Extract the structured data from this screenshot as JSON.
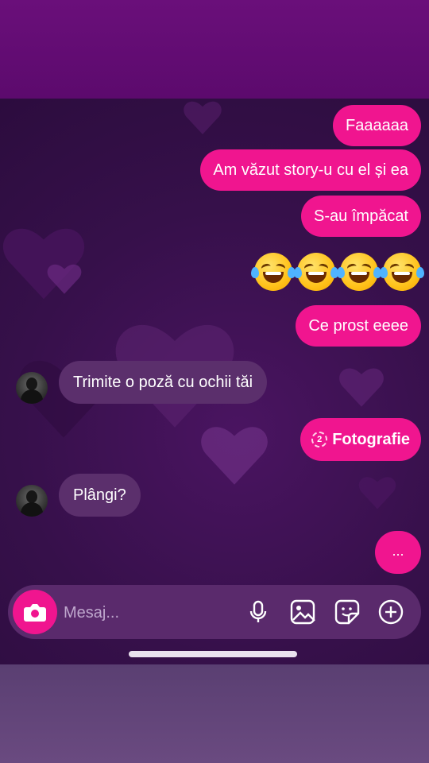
{
  "messages": [
    {
      "type": "outgoing",
      "text": "Faaaaaa"
    },
    {
      "type": "outgoing",
      "text": "Am văzut story-u cu el și ea"
    },
    {
      "type": "outgoing",
      "text": "S-au împăcat"
    },
    {
      "type": "outgoing_emoji",
      "emoji": "face-with-tears-of-joy",
      "count": 4
    },
    {
      "type": "outgoing",
      "text": "Ce prost eeee"
    },
    {
      "type": "incoming",
      "text": "Trimite o poză cu ochii tăi"
    },
    {
      "type": "outgoing_photo",
      "badge": "2",
      "text": "Fotografie"
    },
    {
      "type": "incoming",
      "text": "Plângi?"
    },
    {
      "type": "outgoing_typing",
      "text": "..."
    }
  ],
  "composer": {
    "placeholder": "Mesaj...",
    "icons": [
      "camera-icon",
      "microphone-icon",
      "gallery-icon",
      "sticker-icon",
      "plus-icon"
    ]
  },
  "colors": {
    "outgoing_bubble": "#f0158f",
    "incoming_bubble": "#5b2f6c",
    "background": "#36104a"
  }
}
